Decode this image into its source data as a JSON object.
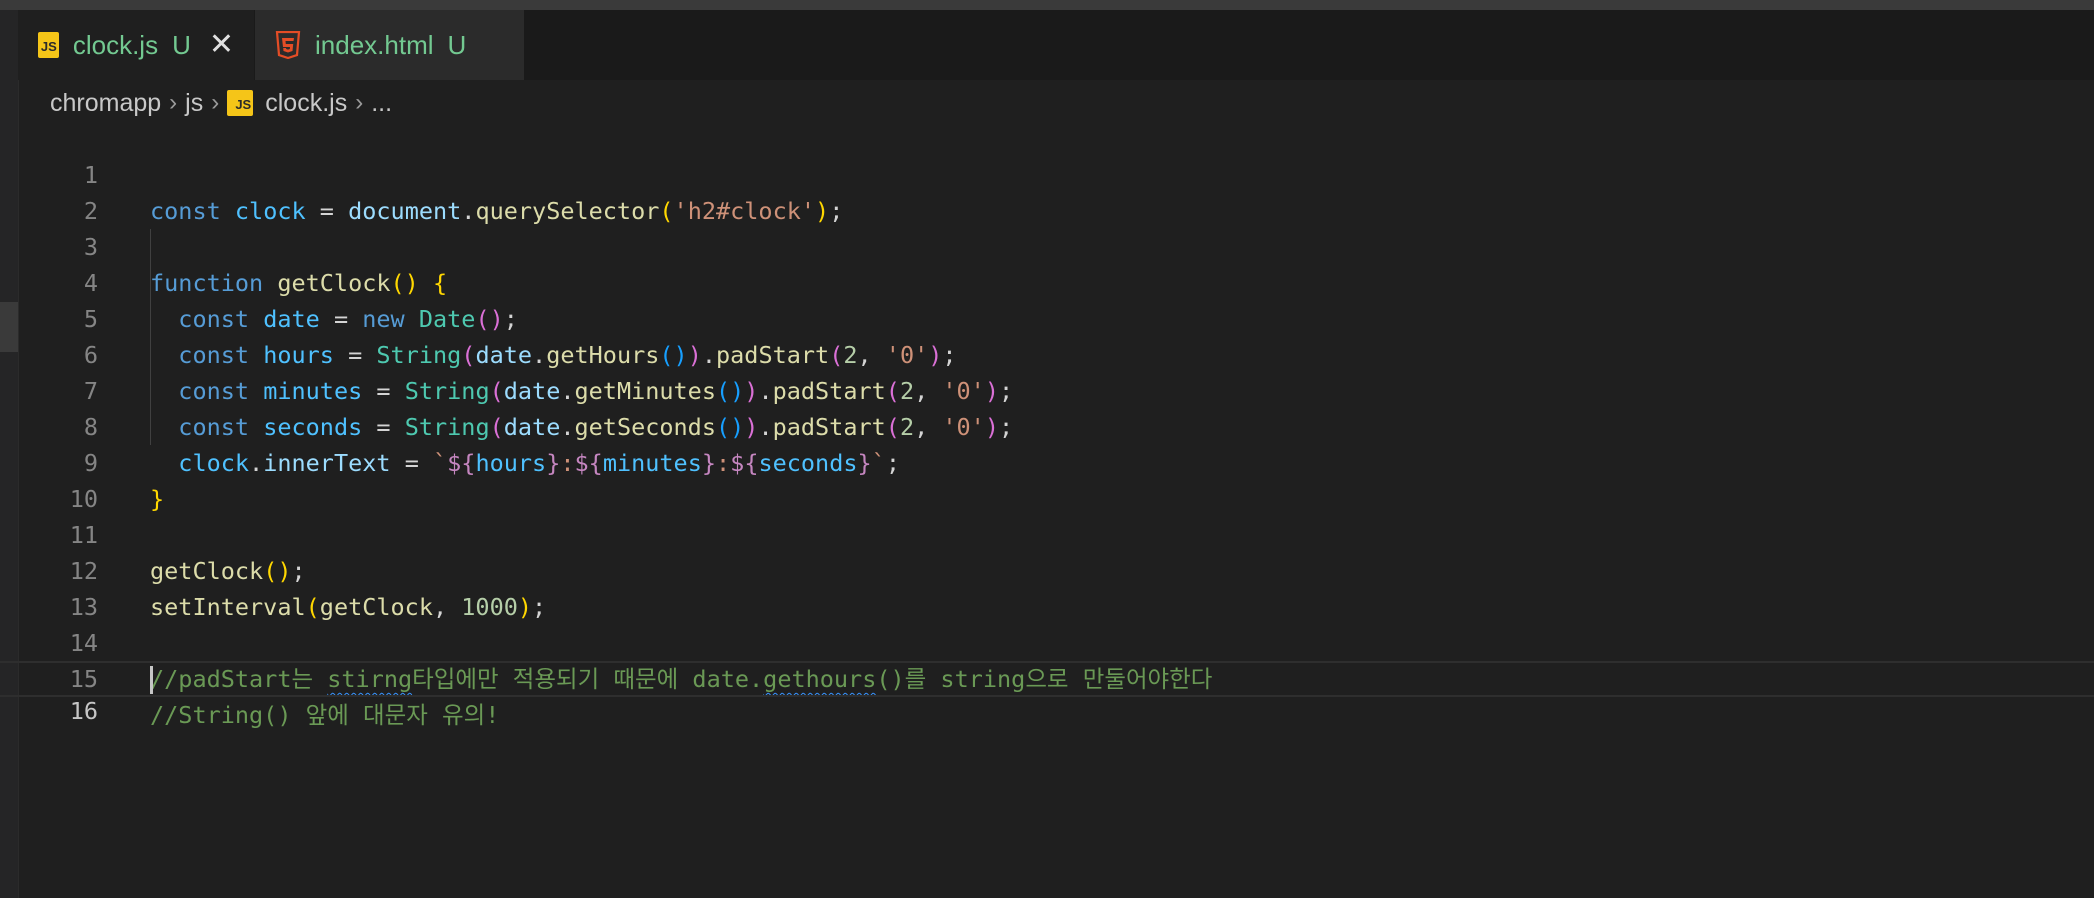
{
  "tabs": [
    {
      "icon": "js-file-icon",
      "icon_text": "JS",
      "name": "clock.js",
      "status": "U",
      "close": "✕",
      "active": true
    },
    {
      "icon": "html5-file-icon",
      "name": "index.html",
      "status": "U",
      "active": false
    }
  ],
  "breadcrumb": {
    "folder": "chromapp",
    "sep": "›",
    "subfolder": "js",
    "file_icon_text": "JS",
    "file": "clock.js",
    "more": "..."
  },
  "line_numbers": [
    "1",
    "2",
    "3",
    "4",
    "5",
    "6",
    "7",
    "8",
    "9",
    "10",
    "11",
    "12",
    "13",
    "14",
    "15",
    "16"
  ],
  "code": {
    "l1": {
      "t1": "const",
      "t2": " ",
      "t3": "clock",
      "t4": " = ",
      "t5": "document",
      "t6": ".",
      "t7": "querySelector",
      "t8": "(",
      "t9": "'h2#clock'",
      "t10": ")",
      "t11": ";"
    },
    "l3": {
      "t1": "function",
      "t2": " ",
      "t3": "getClock",
      "t4": "()",
      "t5": " ",
      "t6": "{"
    },
    "l4": {
      "t1": "  ",
      "t2": "const",
      "t3": " ",
      "t4": "date",
      "t5": " = ",
      "t6": "new",
      "t7": " ",
      "t8": "Date",
      "t9": "()",
      "t10": ";"
    },
    "l5": {
      "t1": "  ",
      "t2": "const",
      "t3": " ",
      "t4": "hours",
      "t5": " = ",
      "t6": "String",
      "t7": "(",
      "t8": "date",
      "t9": ".",
      "t10": "getHours",
      "t11": "()",
      "t12": ")",
      "t13": ".",
      "t14": "padStart",
      "t15": "(",
      "t16": "2",
      "t17": ", ",
      "t18": "'0'",
      "t19": ")",
      "t20": ";"
    },
    "l6": {
      "t1": "  ",
      "t2": "const",
      "t3": " ",
      "t4": "minutes",
      "t5": " = ",
      "t6": "String",
      "t7": "(",
      "t8": "date",
      "t9": ".",
      "t10": "getMinutes",
      "t11": "()",
      "t12": ")",
      "t13": ".",
      "t14": "padStart",
      "t15": "(",
      "t16": "2",
      "t17": ", ",
      "t18": "'0'",
      "t19": ")",
      "t20": ";"
    },
    "l7": {
      "t1": "  ",
      "t2": "const",
      "t3": " ",
      "t4": "seconds",
      "t5": " = ",
      "t6": "String",
      "t7": "(",
      "t8": "date",
      "t9": ".",
      "t10": "getSeconds",
      "t11": "()",
      "t12": ")",
      "t13": ".",
      "t14": "padStart",
      "t15": "(",
      "t16": "2",
      "t17": ", ",
      "t18": "'0'",
      "t19": ")",
      "t20": ";"
    },
    "l8": {
      "t1": "  ",
      "t2": "clock",
      "t3": ".",
      "t4": "innerText",
      "t5": " = ",
      "t6": "`",
      "t7": "${",
      "t8": "hours",
      "t9": "}",
      "t10": ":",
      "t11": "${",
      "t12": "minutes",
      "t13": "}",
      "t14": ":",
      "t15": "${",
      "t16": "seconds",
      "t17": "}",
      "t18": "`",
      "t19": ";"
    },
    "l9": {
      "t1": "}"
    },
    "l11": {
      "t1": "getClock",
      "t2": "()",
      "t3": ";"
    },
    "l12": {
      "t1": "setInterval",
      "t2": "(",
      "t3": "getClock",
      "t4": ", ",
      "t5": "1000",
      "t6": ")",
      "t7": ";"
    },
    "l14": {
      "t1": "//padStart는 ",
      "t2": "stirng",
      "t3": "타입에만 적용되기 때문에 date.",
      "t4": "gethours",
      "t5": "()를 string으로 만둘어야한다"
    },
    "l15": {
      "t1": "//String() 앞에 대문자 유의!"
    }
  },
  "colors": {
    "background": "#1f1f1f",
    "tab_active_bg": "#1f1f1f",
    "tab_inactive_bg": "#2b2b2b",
    "untracked_file": "#73c991",
    "keyword": "#569cd6",
    "function": "#dcdcaa",
    "string": "#ce9178",
    "comment": "#6a9955",
    "number": "#b5cea8"
  }
}
